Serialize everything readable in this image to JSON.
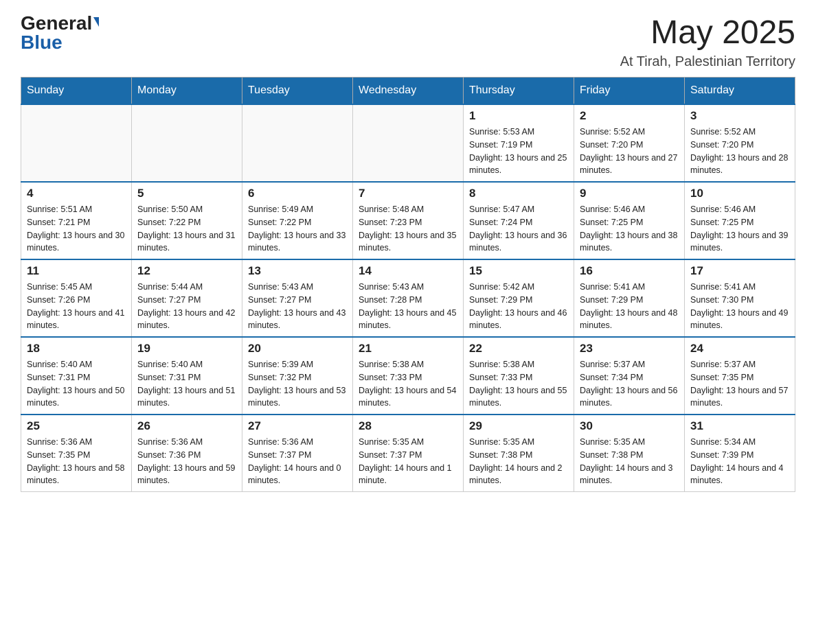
{
  "header": {
    "logo_general": "General",
    "logo_blue": "Blue",
    "month_year": "May 2025",
    "location": "At Tirah, Palestinian Territory"
  },
  "days_of_week": [
    "Sunday",
    "Monday",
    "Tuesday",
    "Wednesday",
    "Thursday",
    "Friday",
    "Saturday"
  ],
  "weeks": [
    [
      {
        "day": "",
        "sunrise": "",
        "sunset": "",
        "daylight": ""
      },
      {
        "day": "",
        "sunrise": "",
        "sunset": "",
        "daylight": ""
      },
      {
        "day": "",
        "sunrise": "",
        "sunset": "",
        "daylight": ""
      },
      {
        "day": "",
        "sunrise": "",
        "sunset": "",
        "daylight": ""
      },
      {
        "day": "1",
        "sunrise": "Sunrise: 5:53 AM",
        "sunset": "Sunset: 7:19 PM",
        "daylight": "Daylight: 13 hours and 25 minutes."
      },
      {
        "day": "2",
        "sunrise": "Sunrise: 5:52 AM",
        "sunset": "Sunset: 7:20 PM",
        "daylight": "Daylight: 13 hours and 27 minutes."
      },
      {
        "day": "3",
        "sunrise": "Sunrise: 5:52 AM",
        "sunset": "Sunset: 7:20 PM",
        "daylight": "Daylight: 13 hours and 28 minutes."
      }
    ],
    [
      {
        "day": "4",
        "sunrise": "Sunrise: 5:51 AM",
        "sunset": "Sunset: 7:21 PM",
        "daylight": "Daylight: 13 hours and 30 minutes."
      },
      {
        "day": "5",
        "sunrise": "Sunrise: 5:50 AM",
        "sunset": "Sunset: 7:22 PM",
        "daylight": "Daylight: 13 hours and 31 minutes."
      },
      {
        "day": "6",
        "sunrise": "Sunrise: 5:49 AM",
        "sunset": "Sunset: 7:22 PM",
        "daylight": "Daylight: 13 hours and 33 minutes."
      },
      {
        "day": "7",
        "sunrise": "Sunrise: 5:48 AM",
        "sunset": "Sunset: 7:23 PM",
        "daylight": "Daylight: 13 hours and 35 minutes."
      },
      {
        "day": "8",
        "sunrise": "Sunrise: 5:47 AM",
        "sunset": "Sunset: 7:24 PM",
        "daylight": "Daylight: 13 hours and 36 minutes."
      },
      {
        "day": "9",
        "sunrise": "Sunrise: 5:46 AM",
        "sunset": "Sunset: 7:25 PM",
        "daylight": "Daylight: 13 hours and 38 minutes."
      },
      {
        "day": "10",
        "sunrise": "Sunrise: 5:46 AM",
        "sunset": "Sunset: 7:25 PM",
        "daylight": "Daylight: 13 hours and 39 minutes."
      }
    ],
    [
      {
        "day": "11",
        "sunrise": "Sunrise: 5:45 AM",
        "sunset": "Sunset: 7:26 PM",
        "daylight": "Daylight: 13 hours and 41 minutes."
      },
      {
        "day": "12",
        "sunrise": "Sunrise: 5:44 AM",
        "sunset": "Sunset: 7:27 PM",
        "daylight": "Daylight: 13 hours and 42 minutes."
      },
      {
        "day": "13",
        "sunrise": "Sunrise: 5:43 AM",
        "sunset": "Sunset: 7:27 PM",
        "daylight": "Daylight: 13 hours and 43 minutes."
      },
      {
        "day": "14",
        "sunrise": "Sunrise: 5:43 AM",
        "sunset": "Sunset: 7:28 PM",
        "daylight": "Daylight: 13 hours and 45 minutes."
      },
      {
        "day": "15",
        "sunrise": "Sunrise: 5:42 AM",
        "sunset": "Sunset: 7:29 PM",
        "daylight": "Daylight: 13 hours and 46 minutes."
      },
      {
        "day": "16",
        "sunrise": "Sunrise: 5:41 AM",
        "sunset": "Sunset: 7:29 PM",
        "daylight": "Daylight: 13 hours and 48 minutes."
      },
      {
        "day": "17",
        "sunrise": "Sunrise: 5:41 AM",
        "sunset": "Sunset: 7:30 PM",
        "daylight": "Daylight: 13 hours and 49 minutes."
      }
    ],
    [
      {
        "day": "18",
        "sunrise": "Sunrise: 5:40 AM",
        "sunset": "Sunset: 7:31 PM",
        "daylight": "Daylight: 13 hours and 50 minutes."
      },
      {
        "day": "19",
        "sunrise": "Sunrise: 5:40 AM",
        "sunset": "Sunset: 7:31 PM",
        "daylight": "Daylight: 13 hours and 51 minutes."
      },
      {
        "day": "20",
        "sunrise": "Sunrise: 5:39 AM",
        "sunset": "Sunset: 7:32 PM",
        "daylight": "Daylight: 13 hours and 53 minutes."
      },
      {
        "day": "21",
        "sunrise": "Sunrise: 5:38 AM",
        "sunset": "Sunset: 7:33 PM",
        "daylight": "Daylight: 13 hours and 54 minutes."
      },
      {
        "day": "22",
        "sunrise": "Sunrise: 5:38 AM",
        "sunset": "Sunset: 7:33 PM",
        "daylight": "Daylight: 13 hours and 55 minutes."
      },
      {
        "day": "23",
        "sunrise": "Sunrise: 5:37 AM",
        "sunset": "Sunset: 7:34 PM",
        "daylight": "Daylight: 13 hours and 56 minutes."
      },
      {
        "day": "24",
        "sunrise": "Sunrise: 5:37 AM",
        "sunset": "Sunset: 7:35 PM",
        "daylight": "Daylight: 13 hours and 57 minutes."
      }
    ],
    [
      {
        "day": "25",
        "sunrise": "Sunrise: 5:36 AM",
        "sunset": "Sunset: 7:35 PM",
        "daylight": "Daylight: 13 hours and 58 minutes."
      },
      {
        "day": "26",
        "sunrise": "Sunrise: 5:36 AM",
        "sunset": "Sunset: 7:36 PM",
        "daylight": "Daylight: 13 hours and 59 minutes."
      },
      {
        "day": "27",
        "sunrise": "Sunrise: 5:36 AM",
        "sunset": "Sunset: 7:37 PM",
        "daylight": "Daylight: 14 hours and 0 minutes."
      },
      {
        "day": "28",
        "sunrise": "Sunrise: 5:35 AM",
        "sunset": "Sunset: 7:37 PM",
        "daylight": "Daylight: 14 hours and 1 minute."
      },
      {
        "day": "29",
        "sunrise": "Sunrise: 5:35 AM",
        "sunset": "Sunset: 7:38 PM",
        "daylight": "Daylight: 14 hours and 2 minutes."
      },
      {
        "day": "30",
        "sunrise": "Sunrise: 5:35 AM",
        "sunset": "Sunset: 7:38 PM",
        "daylight": "Daylight: 14 hours and 3 minutes."
      },
      {
        "day": "31",
        "sunrise": "Sunrise: 5:34 AM",
        "sunset": "Sunset: 7:39 PM",
        "daylight": "Daylight: 14 hours and 4 minutes."
      }
    ]
  ]
}
